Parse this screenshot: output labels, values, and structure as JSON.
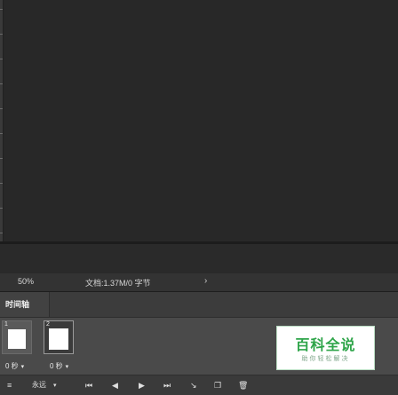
{
  "status_bar": {
    "zoom": "50%",
    "doc_info": "文档:1.37M/0 字节",
    "menu_arrow": "›"
  },
  "timeline": {
    "tab_label": "时间轴",
    "frames": [
      {
        "number": "1",
        "delay": "0 秒",
        "selected": false
      },
      {
        "number": "2",
        "delay": "0 秒",
        "selected": true
      }
    ],
    "delay_caret": "▾",
    "loop_option": "永远",
    "loop_caret": "▾",
    "controls": {
      "convert_icon": "≡",
      "first_frame_icon": "⏮",
      "prev_frame_icon": "◀",
      "play_icon": "▶",
      "next_frame_icon": "⏭",
      "tween_icon": "↘",
      "duplicate_frame_icon": "❐",
      "delete_frame_icon": "🗑"
    }
  },
  "watermark": {
    "title": "百科全说",
    "subtitle": "助你轻松解决"
  },
  "colors": {
    "background": "#282828",
    "panel": "#4a4a4a",
    "statusbar": "#333333",
    "watermark_green": "#2fa54a"
  }
}
